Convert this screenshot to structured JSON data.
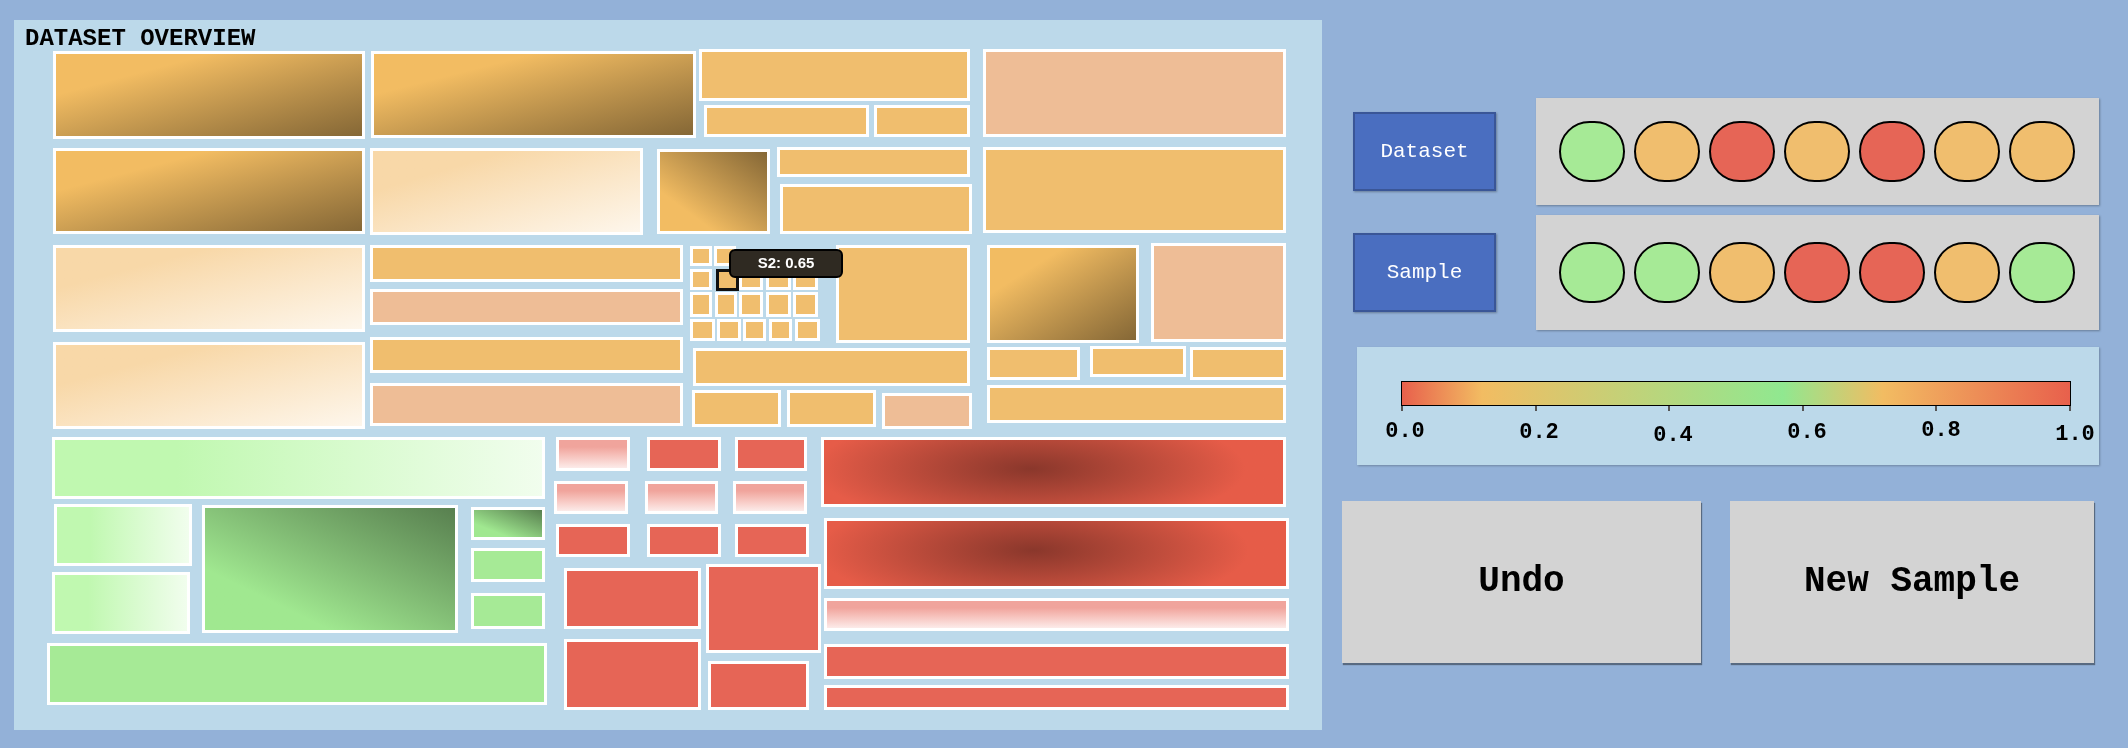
{
  "treemap": {
    "title": "DATASET OVERVIEW",
    "tiles": [
      {
        "color": "#f2bc62",
        "kind": "shade",
        "hovered": false
      },
      {
        "color": "#f2bc62",
        "kind": "shade",
        "hovered": false
      },
      {
        "color": "#f0be6e",
        "kind": "flat",
        "hovered": false
      },
      {
        "color": "#f0be6e",
        "kind": "flat",
        "hovered": false
      },
      {
        "color": "#f0be6e",
        "kind": "flat",
        "hovered": false
      },
      {
        "color": "#eebd96",
        "kind": "flat",
        "hovered": false
      },
      {
        "color": "#f2bc62",
        "kind": "shade",
        "hovered": false
      },
      {
        "color": "#f8d8a8",
        "kind": "fade",
        "hovered": false
      },
      {
        "color": "#f2bc62",
        "kind": "shade",
        "hovered": false
      },
      {
        "color": "#f0be6e",
        "kind": "flat",
        "hovered": false
      },
      {
        "color": "#f0be6e",
        "kind": "flat",
        "hovered": false
      },
      {
        "color": "#f0be6e",
        "kind": "flat",
        "hovered": false
      },
      {
        "color": "#f8d8a8",
        "kind": "fade",
        "hovered": false
      },
      {
        "color": "#f0be6e",
        "kind": "flat",
        "hovered": false
      },
      {
        "color": "#eebd96",
        "kind": "flat",
        "hovered": false
      },
      {
        "color": "#f0be6e",
        "kind": "flat",
        "hovered": false
      },
      {
        "color": "#f0be6e",
        "kind": "flat",
        "hovered": false
      },
      {
        "color": "#f0be6e",
        "kind": "flat",
        "hovered": false
      },
      {
        "color": "#f0be6e",
        "kind": "flat",
        "hovered": true
      },
      {
        "color": "#f0be6e",
        "kind": "flat",
        "hovered": false
      },
      {
        "color": "#f0be6e",
        "kind": "flat",
        "hovered": false
      },
      {
        "color": "#f0be6e",
        "kind": "flat",
        "hovered": false
      },
      {
        "color": "#f0be6e",
        "kind": "flat",
        "hovered": false
      },
      {
        "color": "#f0be6e",
        "kind": "flat",
        "hovered": false
      },
      {
        "color": "#f0be6e",
        "kind": "flat",
        "hovered": false
      },
      {
        "color": "#f0be6e",
        "kind": "flat",
        "hovered": false
      },
      {
        "color": "#f0be6e",
        "kind": "flat",
        "hovered": false
      },
      {
        "color": "#f0be6e",
        "kind": "flat",
        "hovered": false
      },
      {
        "color": "#f0be6e",
        "kind": "flat",
        "hovered": false
      },
      {
        "color": "#f0be6e",
        "kind": "flat",
        "hovered": false
      },
      {
        "color": "#f0be6e",
        "kind": "flat",
        "hovered": false
      },
      {
        "color": "#f0be6e",
        "kind": "flat",
        "hovered": false
      },
      {
        "color": "#f0be6e",
        "kind": "flat",
        "hovered": false
      },
      {
        "color": "#f0be6e",
        "kind": "flat",
        "hovered": false
      },
      {
        "color": "#f8d8a8",
        "kind": "fade",
        "hovered": false
      },
      {
        "color": "#f0be6e",
        "kind": "flat",
        "hovered": false
      },
      {
        "color": "#eebd96",
        "kind": "flat",
        "hovered": false
      },
      {
        "color": "#f0be6e",
        "kind": "flat",
        "hovered": false
      },
      {
        "color": "#f0be6e",
        "kind": "flat",
        "hovered": false
      },
      {
        "color": "#eebd96",
        "kind": "flat",
        "hovered": false
      },
      {
        "color": "#f2bc62",
        "kind": "shade",
        "hovered": false
      },
      {
        "color": "#eebd96",
        "kind": "flat",
        "hovered": false
      },
      {
        "color": "#f0be6e",
        "kind": "flat",
        "hovered": false
      },
      {
        "color": "#f0be6e",
        "kind": "flat",
        "hovered": false
      },
      {
        "color": "#f0be6e",
        "kind": "flat",
        "hovered": false
      },
      {
        "color": "#f0be6e",
        "kind": "flat",
        "hovered": false
      },
      {
        "color": "#c0f8b0",
        "kind": "fade",
        "hovered": false
      },
      {
        "color": "#c0f8b0",
        "kind": "fade",
        "hovered": false
      },
      {
        "color": "#c0f8b0",
        "kind": "fade",
        "hovered": false
      },
      {
        "color": "#a0e890",
        "kind": "shade",
        "hovered": false
      },
      {
        "color": "#a0e890",
        "kind": "shade",
        "hovered": false
      },
      {
        "color": "#a6ea96",
        "kind": "flat",
        "hovered": false
      },
      {
        "color": "#a6ea96",
        "kind": "flat",
        "hovered": false
      },
      {
        "color": "#a6ea96",
        "kind": "flat",
        "hovered": false
      },
      {
        "color": "#f0a49c",
        "kind": "fade",
        "hovered": false
      },
      {
        "color": "#e66556",
        "kind": "flat",
        "hovered": false
      },
      {
        "color": "#e66556",
        "kind": "flat",
        "hovered": false
      },
      {
        "color": "#f0a49c",
        "kind": "fade",
        "hovered": false
      },
      {
        "color": "#f0a49c",
        "kind": "fade",
        "hovered": false
      },
      {
        "color": "#f0a49c",
        "kind": "fade",
        "hovered": false
      },
      {
        "color": "#e66556",
        "kind": "flat",
        "hovered": false
      },
      {
        "color": "#e66556",
        "kind": "flat",
        "hovered": false
      },
      {
        "color": "#e66556",
        "kind": "flat",
        "hovered": false
      },
      {
        "color": "#e66556",
        "kind": "flat",
        "hovered": false
      },
      {
        "color": "#e66556",
        "kind": "flat",
        "hovered": false
      },
      {
        "color": "#e66556",
        "kind": "flat",
        "hovered": false
      },
      {
        "color": "#e66556",
        "kind": "flat",
        "hovered": false
      },
      {
        "color": "#e65c48",
        "kind": "glow",
        "hovered": false
      },
      {
        "color": "#e65c48",
        "kind": "glow",
        "hovered": false
      },
      {
        "color": "#f0a49c",
        "kind": "fade",
        "hovered": false
      },
      {
        "color": "#e66556",
        "kind": "flat",
        "hovered": false
      },
      {
        "color": "#e66556",
        "kind": "flat",
        "hovered": false
      }
    ],
    "tooltip": {
      "text": "S2: 0.65"
    }
  },
  "selectors": [
    {
      "label": "Dataset",
      "dots": [
        {
          "color": "#a6ea96"
        },
        {
          "color": "#f0be6e"
        },
        {
          "color": "#e66556"
        },
        {
          "color": "#f0be6e"
        },
        {
          "color": "#e66556"
        },
        {
          "color": "#f0be6e"
        },
        {
          "color": "#f0be6e"
        }
      ]
    },
    {
      "label": "Sample",
      "dots": [
        {
          "color": "#a6ea96"
        },
        {
          "color": "#a6ea96"
        },
        {
          "color": "#f0be6e"
        },
        {
          "color": "#e66556"
        },
        {
          "color": "#e66556"
        },
        {
          "color": "#f0be6e"
        },
        {
          "color": "#a6ea96"
        }
      ]
    }
  ],
  "color_scale": {
    "ticks": [
      "0.0",
      "0.2",
      "0.4",
      "0.6",
      "0.8",
      "1.0"
    ]
  },
  "buttons": [
    "Undo",
    "New Sample"
  ]
}
